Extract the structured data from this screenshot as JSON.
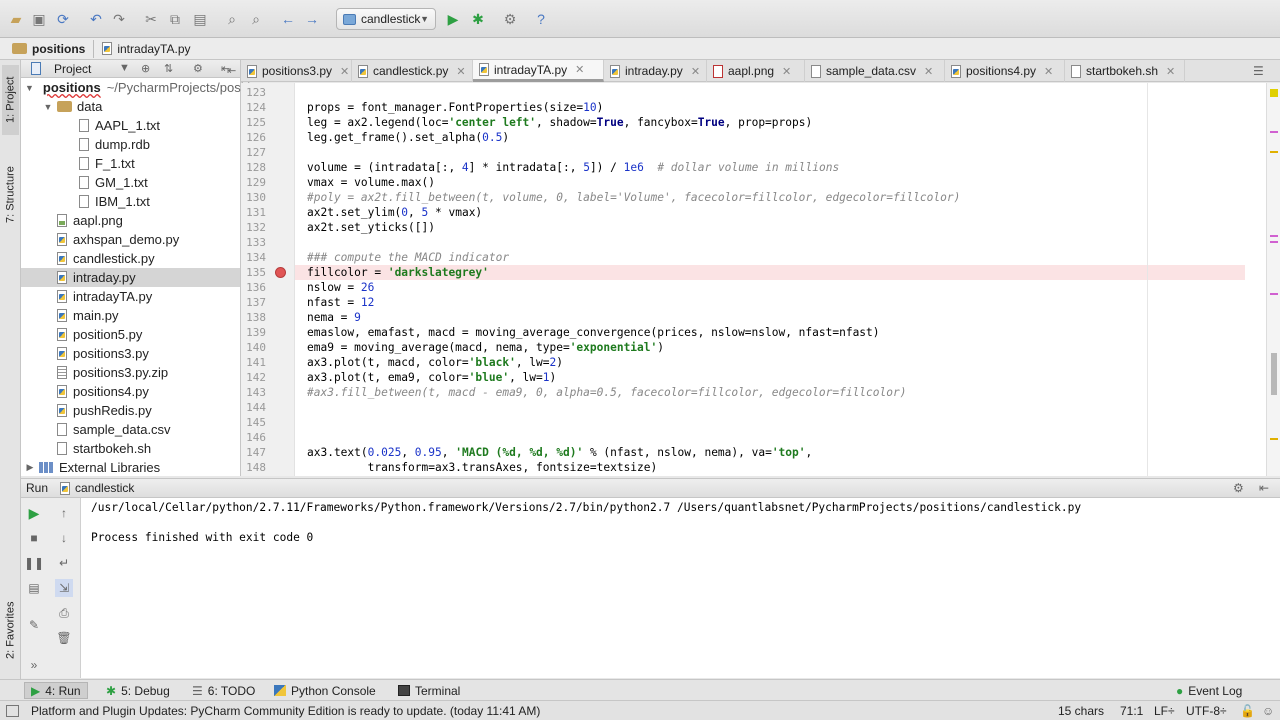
{
  "toolbar": {
    "run_config": "candlestick"
  },
  "breadcrumb": [
    "positions",
    "intradayTA.py"
  ],
  "left_stripe": {
    "project_tab": "1: Project",
    "structure_tab": "7: Structure",
    "favorites_tab": "2: Favorites"
  },
  "project": {
    "header_title": "Project",
    "root_name": "positions",
    "root_path": "~/PycharmProjects/positions",
    "items": [
      {
        "label": "data",
        "kind": "folder",
        "depth": 1
      },
      {
        "label": "AAPL_1.txt",
        "kind": "file",
        "depth": 2
      },
      {
        "label": "dump.rdb",
        "kind": "file",
        "depth": 2
      },
      {
        "label": "F_1.txt",
        "kind": "file",
        "depth": 2
      },
      {
        "label": "GM_1.txt",
        "kind": "file",
        "depth": 2
      },
      {
        "label": "IBM_1.txt",
        "kind": "file",
        "depth": 2
      },
      {
        "label": "aapl.png",
        "kind": "img",
        "depth": 1
      },
      {
        "label": "axhspan_demo.py",
        "kind": "py",
        "depth": 1
      },
      {
        "label": "candlestick.py",
        "kind": "py",
        "depth": 1
      },
      {
        "label": "intraday.py",
        "kind": "py",
        "depth": 1,
        "selected": true
      },
      {
        "label": "intradayTA.py",
        "kind": "py",
        "depth": 1
      },
      {
        "label": "main.py",
        "kind": "py",
        "depth": 1
      },
      {
        "label": "position5.py",
        "kind": "py",
        "depth": 1
      },
      {
        "label": "positions3.py",
        "kind": "py",
        "depth": 1
      },
      {
        "label": "positions3.py.zip",
        "kind": "zip",
        "depth": 1
      },
      {
        "label": "positions4.py",
        "kind": "py",
        "depth": 1
      },
      {
        "label": "pushRedis.py",
        "kind": "py",
        "depth": 1
      },
      {
        "label": "sample_data.csv",
        "kind": "file",
        "depth": 1
      },
      {
        "label": "startbokeh.sh",
        "kind": "file",
        "depth": 1
      }
    ],
    "external_libraries": "External Libraries"
  },
  "tabs": [
    {
      "label": "positions3.py",
      "kind": "py"
    },
    {
      "label": "candlestick.py",
      "kind": "py"
    },
    {
      "label": "intradayTA.py",
      "kind": "py",
      "active": true
    },
    {
      "label": "intraday.py",
      "kind": "py"
    },
    {
      "label": "aapl.png",
      "kind": "img"
    },
    {
      "label": "sample_data.csv",
      "kind": "file"
    },
    {
      "label": "positions4.py",
      "kind": "py"
    },
    {
      "label": "startbokeh.sh",
      "kind": "file"
    }
  ],
  "editor": {
    "lines": [
      {
        "n": "123",
        "text": ""
      },
      {
        "n": "124",
        "text": "props = font_manager.FontProperties(size=10)"
      },
      {
        "n": "125",
        "text": "leg = ax2.legend(loc='center left', shadow=True, fancybox=True, prop=props)"
      },
      {
        "n": "126",
        "text": "leg.get_frame().set_alpha(0.5)"
      },
      {
        "n": "127",
        "text": ""
      },
      {
        "n": "128",
        "text": "volume = (intradata[:, 4] * intradata[:, 5]) / 1e6  # dollar volume in millions"
      },
      {
        "n": "129",
        "text": "vmax = volume.max()"
      },
      {
        "n": "130",
        "text": "#poly = ax2t.fill_between(t, volume, 0, label='Volume', facecolor=fillcolor, edgecolor=fillcolor)",
        "comment": true
      },
      {
        "n": "131",
        "text": "ax2t.set_ylim(0, 5 * vmax)"
      },
      {
        "n": "132",
        "text": "ax2t.set_yticks([])"
      },
      {
        "n": "133",
        "text": ""
      },
      {
        "n": "134",
        "text": "### compute the MACD indicator",
        "comment": true
      },
      {
        "n": "135",
        "text": "fillcolor = 'darkslategrey'",
        "breakpoint": true
      },
      {
        "n": "136",
        "text": "nslow = 26"
      },
      {
        "n": "137",
        "text": "nfast = 12"
      },
      {
        "n": "138",
        "text": "nema = 9"
      },
      {
        "n": "139",
        "text": "emaslow, emafast, macd = moving_average_convergence(prices, nslow=nslow, nfast=nfast)"
      },
      {
        "n": "140",
        "text": "ema9 = moving_average(macd, nema, type='exponential')"
      },
      {
        "n": "141",
        "text": "ax3.plot(t, macd, color='black', lw=2)"
      },
      {
        "n": "142",
        "text": "ax3.plot(t, ema9, color='blue', lw=1)"
      },
      {
        "n": "143",
        "text": "#ax3.fill_between(t, macd - ema9, 0, alpha=0.5, facecolor=fillcolor, edgecolor=fillcolor)",
        "comment": true
      },
      {
        "n": "144",
        "text": ""
      },
      {
        "n": "145",
        "text": ""
      },
      {
        "n": "146",
        "text": ""
      },
      {
        "n": "147",
        "text": "ax3.text(0.025, 0.95, 'MACD (%d, %d, %d)' % (nfast, nslow, nema), va='top',"
      },
      {
        "n": "148",
        "text": "         transform=ax3.transAxes, fontsize=textsize)"
      }
    ]
  },
  "run_panel": {
    "tab_label": "Run",
    "config_name": "candlestick",
    "output": [
      "/usr/local/Cellar/python/2.7.11/Frameworks/Python.framework/Versions/2.7/bin/python2.7 /Users/quantlabsnet/PycharmProjects/positions/candlestick.py",
      "",
      "Process finished with exit code 0"
    ]
  },
  "bottom_tabs": {
    "run": "4: Run",
    "debug": "5: Debug",
    "todo": "6: TODO",
    "python_console": "Python Console",
    "terminal": "Terminal",
    "event_log": "Event Log"
  },
  "status_bar": {
    "message": "Platform and Plugin Updates: PyCharm Community Edition is ready to update. (today 11:41 AM)",
    "chars": "15 chars",
    "position": "71:1",
    "line_sep": "LF÷",
    "encoding": "UTF-8÷"
  },
  "colors": {
    "breakpoint": "#e05555",
    "breakpoint_line": "#fbe3e4",
    "string": "#1e7a1e",
    "number": "#1a33c8",
    "comment": "#888888",
    "run_green": "#2ea043"
  }
}
